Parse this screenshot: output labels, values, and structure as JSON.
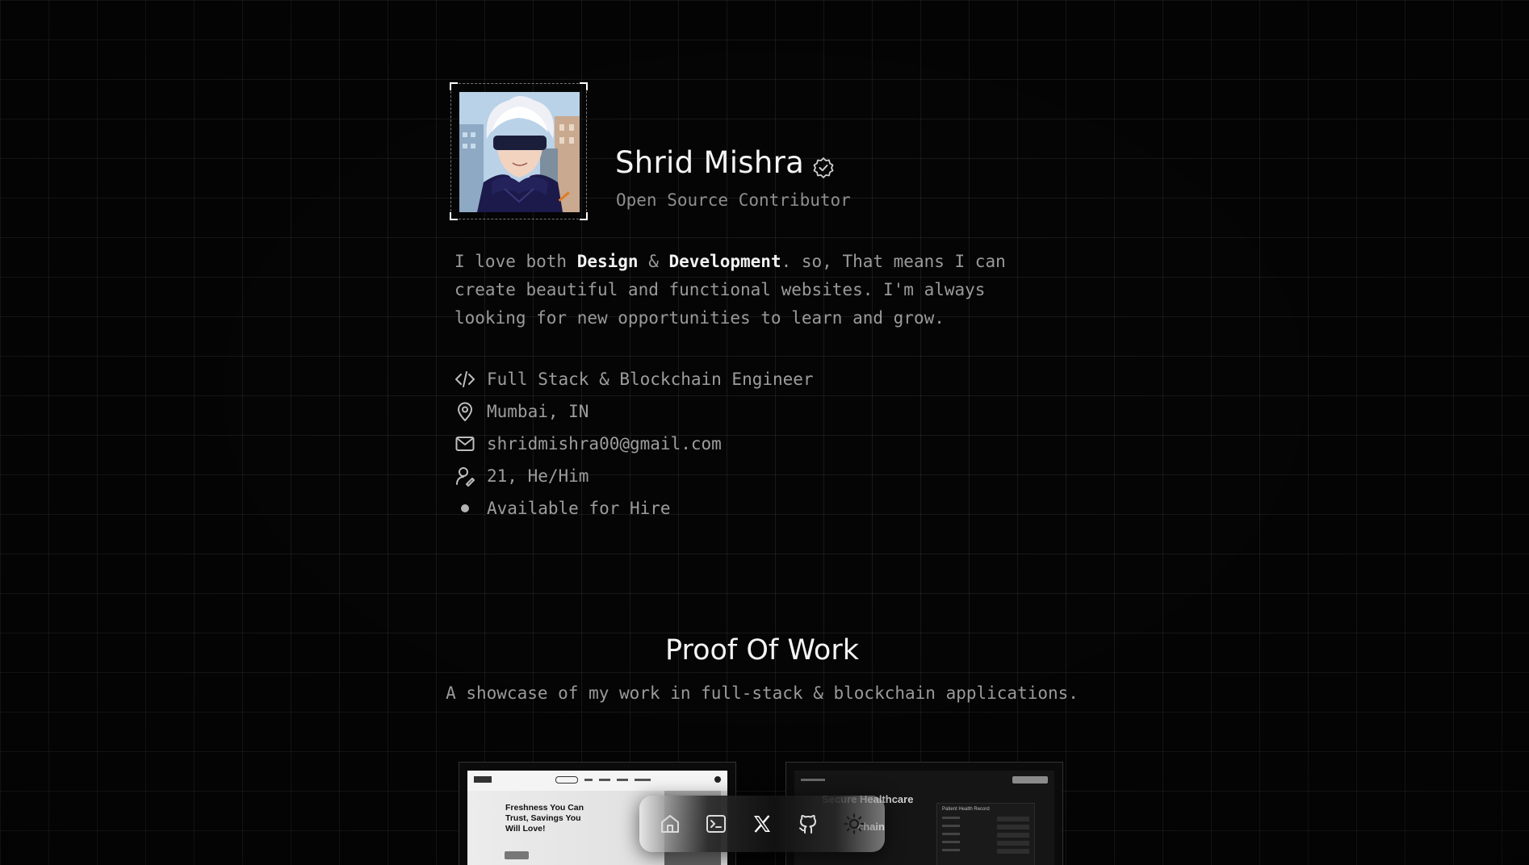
{
  "profile": {
    "name": "Shrid Mishra",
    "verified_icon": "verified-badge-icon",
    "role": "Open Source Contributor"
  },
  "bio": {
    "part1": "I love both ",
    "highlight1": "Design",
    "part2": " & ",
    "highlight2": "Development",
    "part3": ". so, That means I can create beautiful and functional websites. I'm always looking for new opportunities to learn and grow."
  },
  "details": [
    {
      "icon": "code-icon",
      "text": "Full Stack & Blockchain Engineer"
    },
    {
      "icon": "location-pin-icon",
      "text": "Mumbai, IN"
    },
    {
      "icon": "mail-icon",
      "text": "shridmishra00@gmail.com"
    },
    {
      "icon": "user-pronouns-icon",
      "text": "21, He/Him"
    },
    {
      "icon": "status-dot-icon",
      "text": "Available for Hire"
    }
  ],
  "proof_of_work": {
    "title": "Proof Of Work",
    "subtitle": "A showcase of my work in full-stack & blockchain applications.",
    "projects": [
      {
        "hero_text": "Freshness You Can Trust, Savings You Will Love!"
      },
      {
        "hero_text_1": "Secure Healthcare",
        "hero_text_2": "chain",
        "panel_title": "Patient Health Record"
      }
    ]
  },
  "dock": {
    "items": [
      "home-icon",
      "terminal-icon",
      "x-logo-icon",
      "github-icon",
      "sun-icon"
    ]
  },
  "colors": {
    "background": "#050505",
    "text_primary": "#f4f4f4",
    "text_muted": "#9a9a9a",
    "grid_line": "rgba(255,255,255,0.075)"
  }
}
